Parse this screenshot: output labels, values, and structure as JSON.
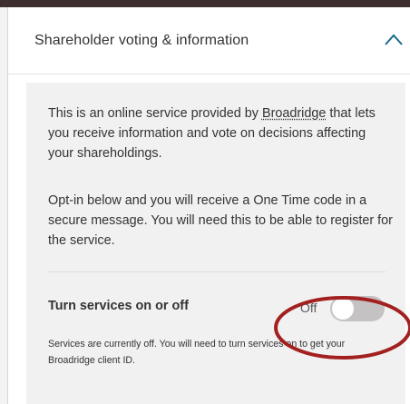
{
  "panel": {
    "title": "Shareholder voting & information",
    "icon": "chevron-up-icon"
  },
  "content": {
    "intro_before_link": "This is an online service provided by ",
    "intro_link": "Broadridge",
    "intro_after_link": " that lets you receive information and vote on decisions affecting your shareholdings.",
    "optin_text": "Opt-in below and you will receive a One Time code in a secure message. You will need this to be able to register for the service."
  },
  "toggle": {
    "label": "Turn services on or off",
    "state_text": "Off",
    "is_on": false
  },
  "status": {
    "text": "Services are currently off. You will need to turn services on to get your Broadridge client ID."
  },
  "colors": {
    "page_background": "#f4f3f3",
    "content_background": "#f2f1f1",
    "accent": "#1a6a8c",
    "toggle_off": "#c4c2c2",
    "annotation_circle": "#a32020"
  }
}
